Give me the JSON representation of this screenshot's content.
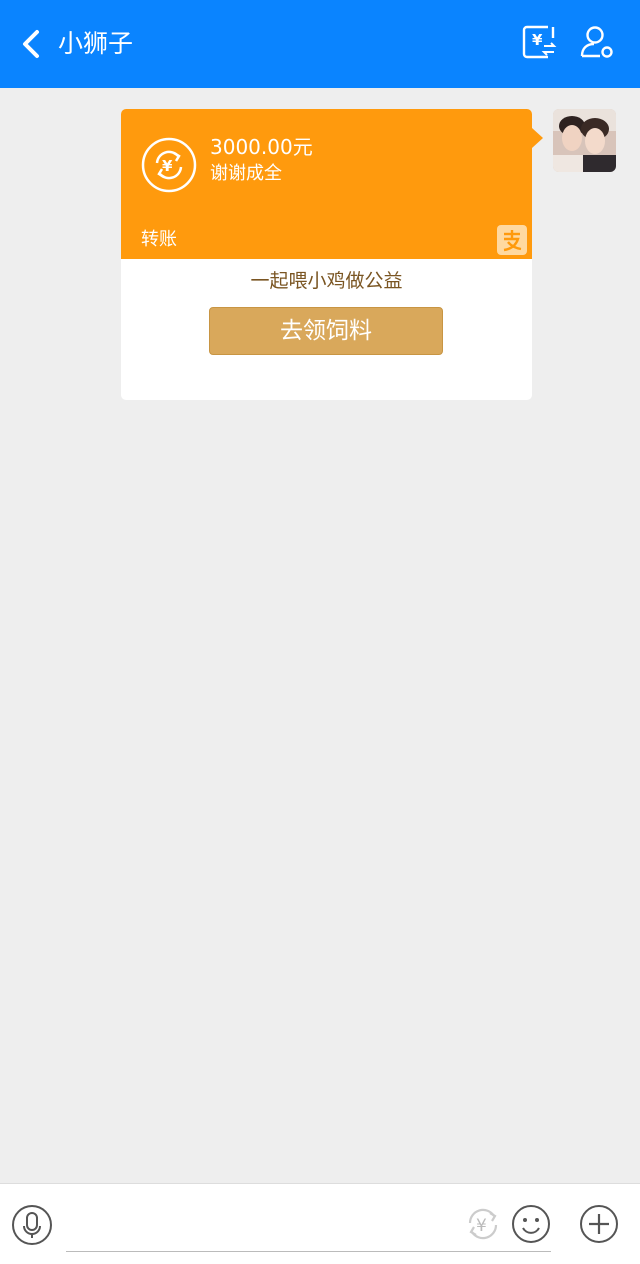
{
  "header": {
    "title": "小狮子",
    "background_color": "#0a84ff",
    "icons": [
      "back-arrow-icon",
      "transfer-money-icon",
      "profile-settings-icon"
    ]
  },
  "message": {
    "avatar_icon": "user-avatar-photo",
    "card": {
      "accent_color": "#ff9a0d",
      "icon": "transfer-yuan-icon",
      "amount": "3000.00元",
      "note": "谢谢成全",
      "type_label": "转账",
      "brand_icon": "alipay-logo",
      "promo_text": "一起喂小鸡做公益",
      "button_label": "去领饲料",
      "button_color": "#d9a85b"
    }
  },
  "bottom_bar": {
    "icons": [
      "microphone-icon",
      "transfer-money-icon",
      "emoji-icon",
      "plus-icon"
    ],
    "input_value": ""
  }
}
